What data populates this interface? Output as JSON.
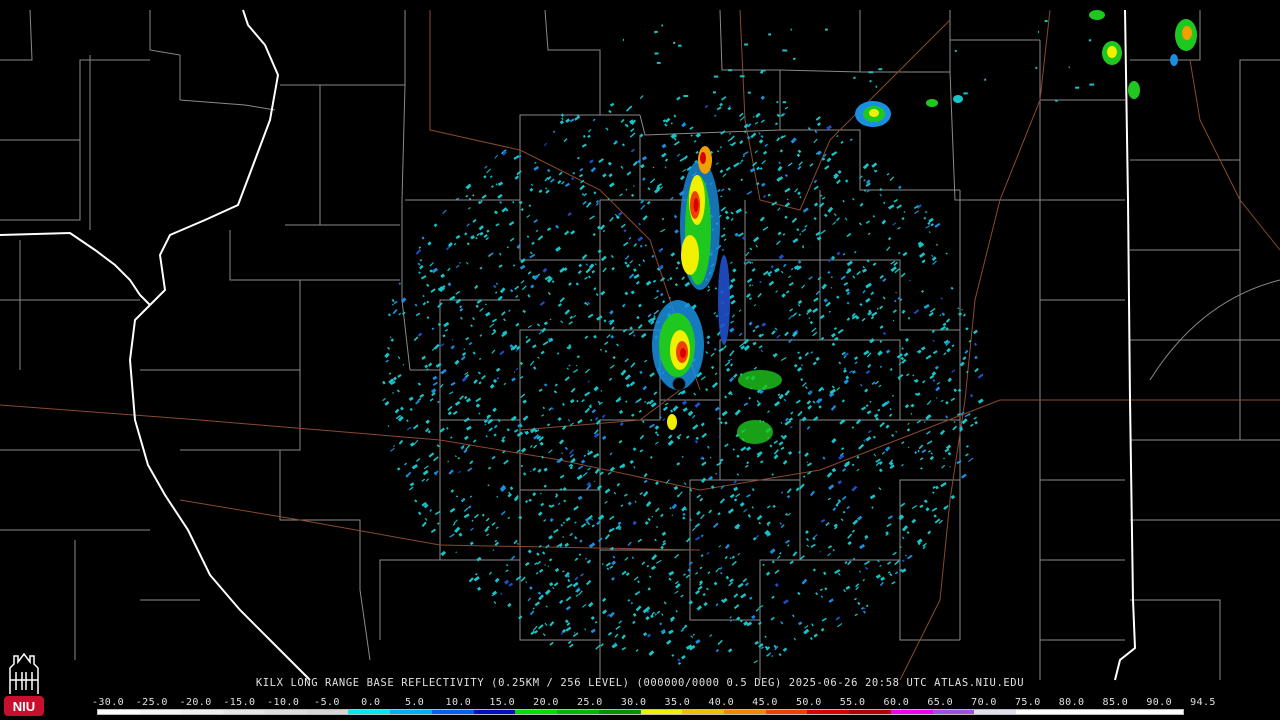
{
  "caption": {
    "text": "KILX LONG RANGE BASE REFLECTIVITY (0.25KM / 256 LEVEL) (000000/0000 0.5 DEG) 2025-06-26 20:58 UTC  ATLAS.NIU.EDU"
  },
  "legend": {
    "labels": [
      "-30.0",
      "-25.0",
      "-20.0",
      "-15.0",
      "-10.0",
      "-5.0",
      "0.0",
      "5.0",
      "10.0",
      "15.0",
      "20.0",
      "25.0",
      "30.0",
      "35.0",
      "40.0",
      "45.0",
      "50.0",
      "55.0",
      "60.0",
      "65.0",
      "70.0",
      "75.0",
      "80.0",
      "85.0",
      "90.0",
      "94.5"
    ],
    "colors": [
      "#ffffff",
      "#f6f6f6",
      "#eeeeee",
      "#e6e6e6",
      "#dedede",
      "#d6d6d6",
      "#00e8f0",
      "#00b0f0",
      "#0060f0",
      "#0010c0",
      "#00e000",
      "#00b800",
      "#009000",
      "#f0f000",
      "#f0c000",
      "#f08800",
      "#f04000",
      "#d80000",
      "#b00000",
      "#f000f0",
      "#a050e0",
      "#e0e0f0",
      "#ffffff",
      "#ffffff",
      "#ffffff",
      "#ffffff"
    ]
  },
  "logo": {
    "text": "NIU",
    "colors": {
      "badge": "#c8102e",
      "building": "#ffffff"
    }
  },
  "map": {
    "colors": {
      "state_border": "#ffffff",
      "county_border": "#8a8a8a",
      "road": "#8b4a2e",
      "radar_site": "#000000"
    },
    "reflectivity_colors": [
      "#17c4c8",
      "#1a8fe0",
      "#1f4fc8",
      "#1ec81e",
      "#10a010",
      "#f0f000",
      "#f0a000",
      "#f04000",
      "#d80000"
    ]
  }
}
